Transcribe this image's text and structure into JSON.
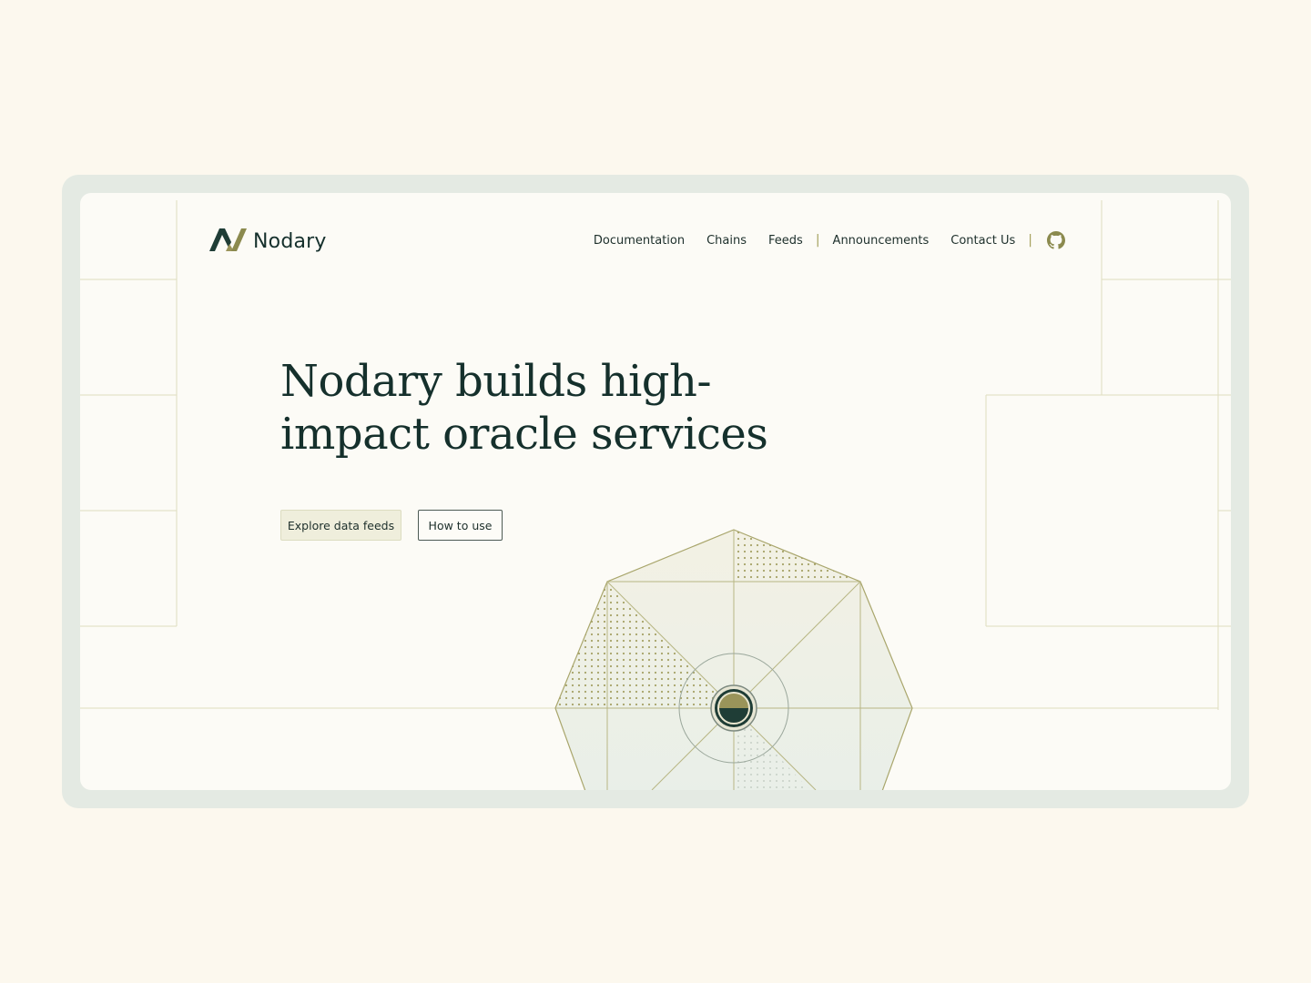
{
  "brand": {
    "name": "Nodary",
    "logo_icon": "nodary-logo-icon"
  },
  "nav": {
    "items": [
      {
        "label": "Documentation"
      },
      {
        "label": "Chains"
      },
      {
        "label": "Feeds"
      },
      {
        "label": "Announcements"
      },
      {
        "label": "Contact Us"
      }
    ],
    "separator": "|",
    "github_icon": "github-icon"
  },
  "hero": {
    "title": "Nodary builds high-impact oracle services",
    "primary_button": "Explore data feeds",
    "secondary_button": "How to use"
  },
  "colors": {
    "background": "#fcf8ee",
    "frame": "#e4eae3",
    "text_dark": "#15302c",
    "accent_olive": "#8b8a4e",
    "button_fill": "#efeedc"
  }
}
